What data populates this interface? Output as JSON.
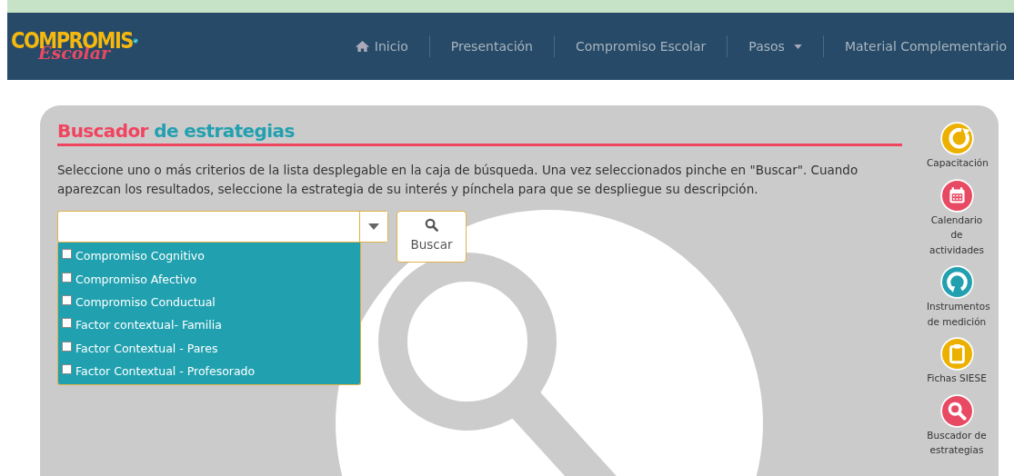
{
  "logo": {
    "word": "COMPROMIS",
    "script": "Escolar"
  },
  "nav": [
    {
      "label": "Inicio",
      "dropdown": false
    },
    {
      "label": "Presentación",
      "dropdown": false
    },
    {
      "label": "Compromiso Escolar",
      "dropdown": false
    },
    {
      "label": "Pasos",
      "dropdown": true
    },
    {
      "label": "Material Complementario",
      "dropdown": false
    }
  ],
  "panel": {
    "title_first": "Buscador",
    "title_rest": "de estrategias",
    "description": "Seleccione uno o más criterios de la lista desplegable en la caja de búsqueda. Una vez seleccionados pinche en \"Buscar\". Cuando aparezcan los resultados, seleccione la estrategia de su interés y pínchela para que se despliegue su descripción.",
    "search_button": "Buscar",
    "options": [
      {
        "label": "Compromiso Cognitivo",
        "checked": false
      },
      {
        "label": "Compromiso Afectivo",
        "checked": false
      },
      {
        "label": "Compromiso Conductual",
        "checked": false
      },
      {
        "label": "Factor contextual- Familia",
        "checked": false
      },
      {
        "label": "Factor Contextual - Pares",
        "checked": false
      },
      {
        "label": "Factor Contextual - Profesorado",
        "checked": false
      }
    ]
  },
  "side_links": [
    {
      "label": "Capacitación",
      "kind": "refresh",
      "color": "#ecb100"
    },
    {
      "label": "Calendario de actividades",
      "kind": "calendar",
      "color": "#e84a63"
    },
    {
      "label": "Instrumentos de medición",
      "kind": "cycle",
      "color": "#22a0b0"
    },
    {
      "label": "Fichas SIESE",
      "kind": "clipboard",
      "color": "#ecb100"
    },
    {
      "label": "Buscador de estrategias",
      "kind": "search",
      "color": "#e84a63"
    }
  ]
}
